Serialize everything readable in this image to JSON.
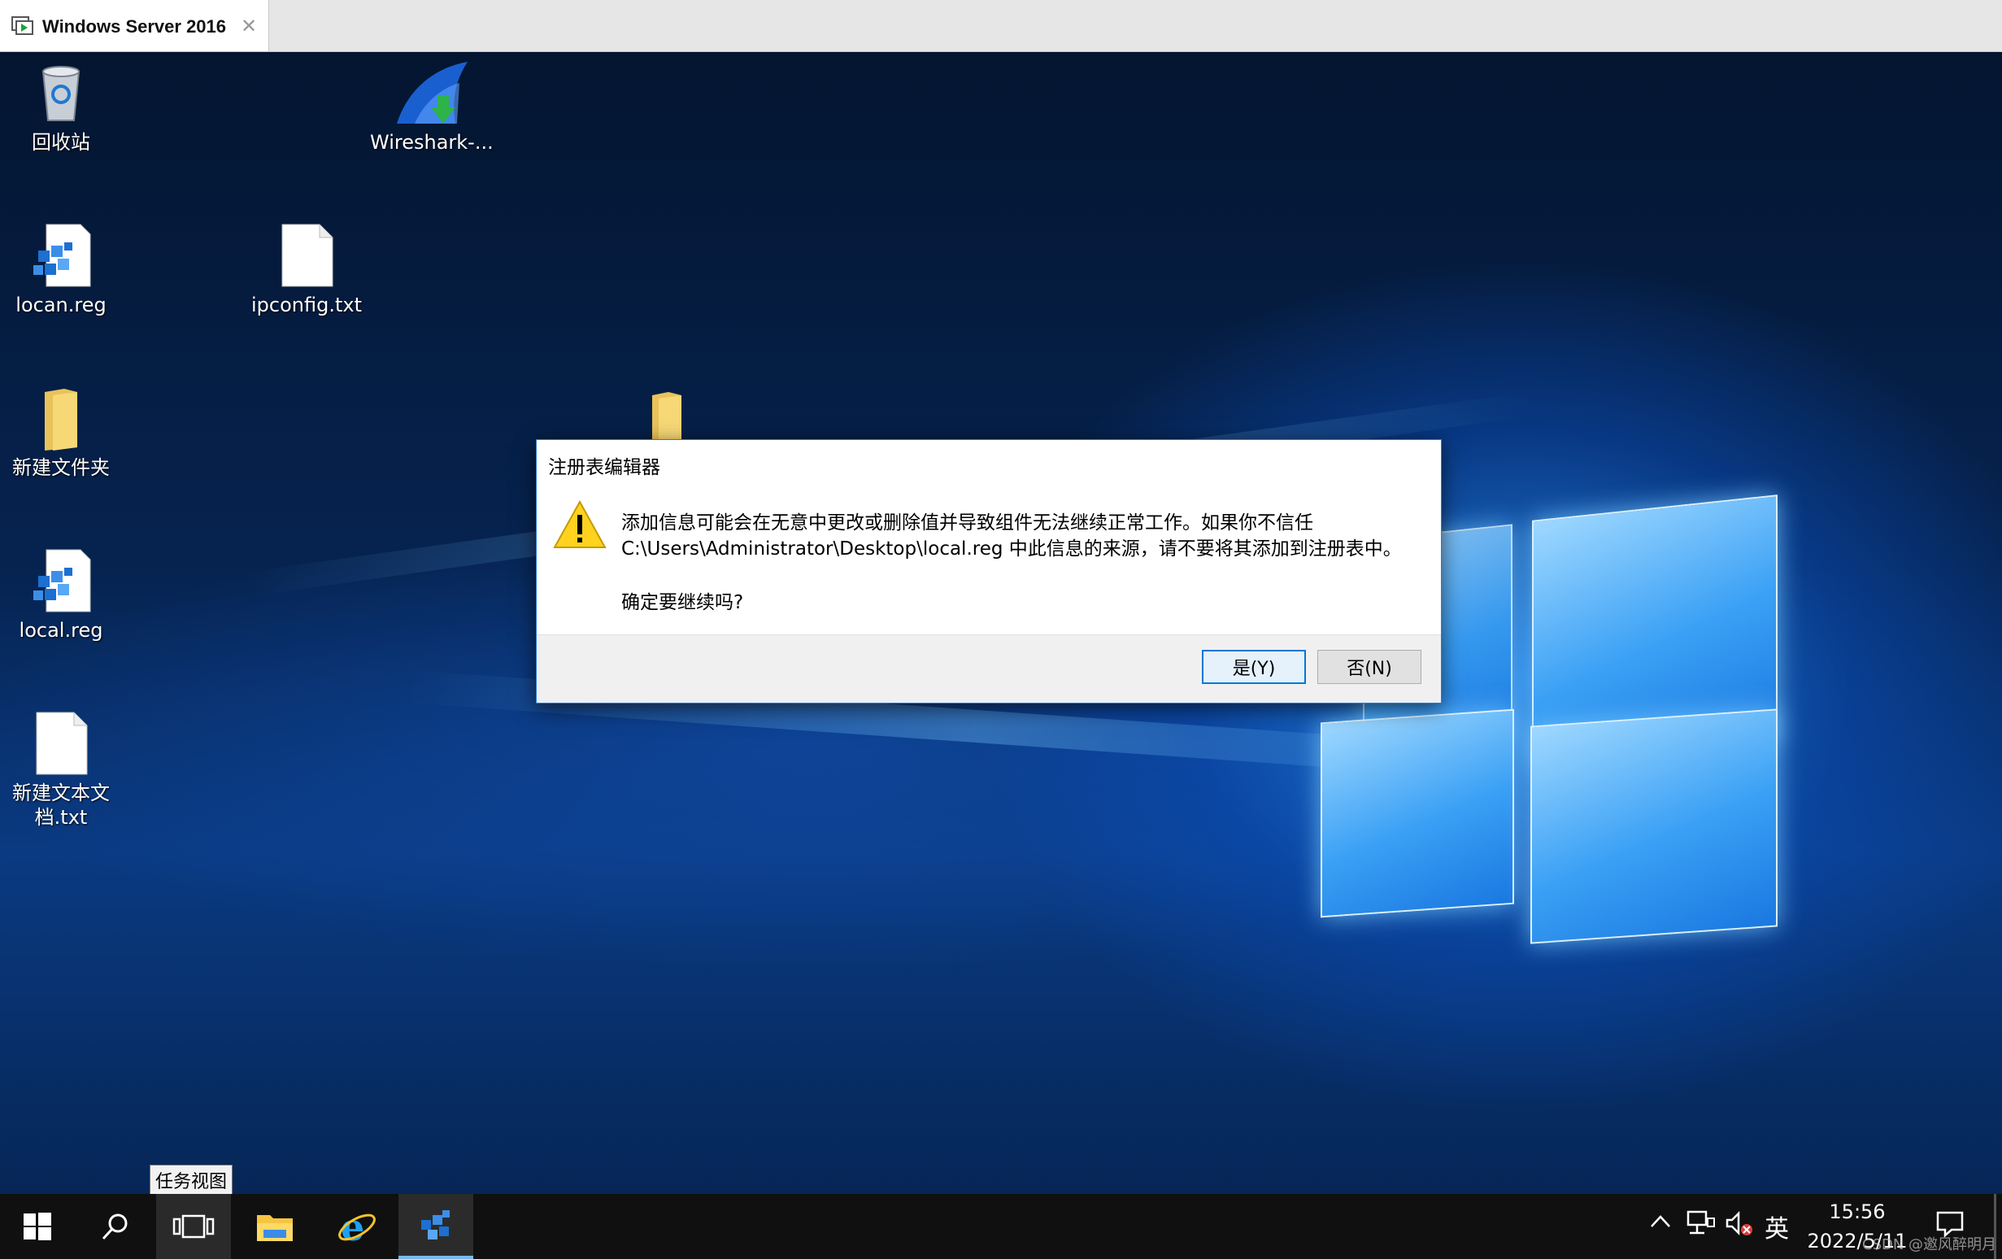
{
  "vm_tab": {
    "title": "Windows Server 2016",
    "close": "✕"
  },
  "desktop_icons": [
    {
      "label": "回收站"
    },
    {
      "label": "Wireshark-..."
    },
    {
      "label": "locan.reg"
    },
    {
      "label": "ipconfig.txt"
    },
    {
      "label": "新建文件夹"
    },
    {
      "label": "local.reg"
    },
    {
      "label": "新建文本文档.txt"
    }
  ],
  "dialog": {
    "title": "注册表编辑器",
    "message_line1": "添加信息可能会在无意中更改或删除值并导致组件无法继续正常工作。如果你不信任",
    "message_line2": "C:\\Users\\Administrator\\Desktop\\local.reg 中此信息的来源，请不要将其添加到注册表中。",
    "question": "确定要继续吗?",
    "yes_label": "是(Y)",
    "no_label": "否(N)"
  },
  "tooltip": {
    "text": "任务视图"
  },
  "taskbar": {
    "ime": "英",
    "time": "15:56",
    "date": "2022/5/11",
    "watermark": "CSDN @邀风醉明月"
  },
  "colors": {
    "taskbar": "#101010",
    "dialog_border": "#2a7bd4",
    "accent": "#0078d7"
  }
}
